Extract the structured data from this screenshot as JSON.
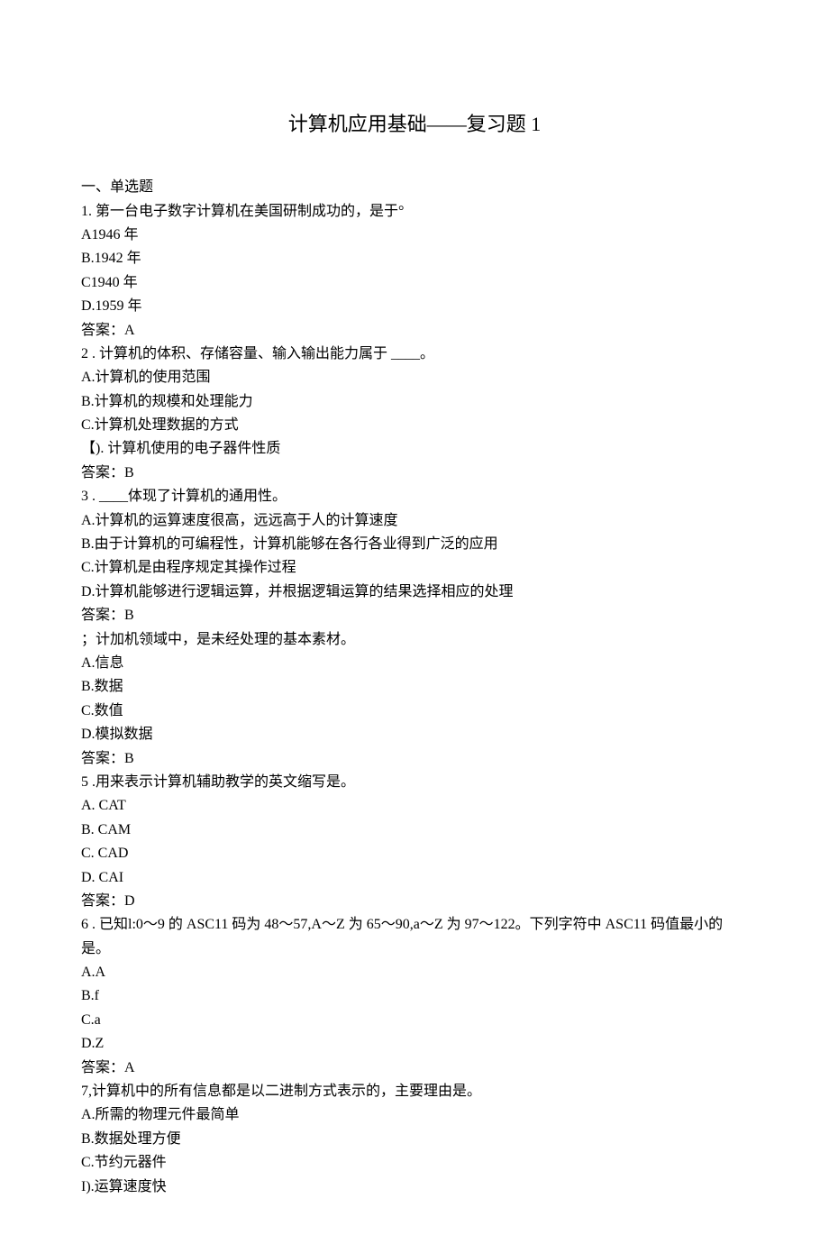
{
  "title": "计算机应用基础——复习题 1",
  "section_header": "一、单选题",
  "q1": {
    "text": "1. 第一台电子数字计算机在美国研制成功的，是于°",
    "a": "A1946 年",
    "b": "B.1942 年",
    "c": "C1940 年",
    "d": "D.1959 年",
    "ans": "答案：A"
  },
  "q2": {
    "text": "2   . 计算机的体积、存储容量、输入输出能力属于 ____。",
    "a": "A.计算机的使用范围",
    "b": "B.计算机的规模和处理能力",
    "c": "C.计算机处理数据的方式",
    "d": "【). 计算机使用的电子器件性质",
    "ans": "答案：B"
  },
  "q3": {
    "text": "3   . ____体现了计算机的通用性。",
    "a": "A.计算机的运算速度很高，远远高于人的计算速度",
    "b": "B.由于计算机的可编程性，计算机能够在各行各业得到广泛的应用",
    "c": "C.计算机是由程序规定其操作过程",
    "d": "D.计算机能够进行逻辑运算，并根据逻辑运算的结果选择相应的处理",
    "ans": "答案：B"
  },
  "q4": {
    "text": "；计加机领域中，是未经处理的基本素材。",
    "a": "A.信息",
    "b": "B.数据",
    "c": "C.数值",
    "d": "D.模拟数据",
    "ans": "答案：B"
  },
  "q5": {
    "text": "5   .用来表示计算机辅助教学的英文缩写是。",
    "a": "A.   CAT",
    "b": "B.   CAM",
    "c": "C.   CAD",
    "d": "D.   CAI",
    "ans": "答案：D"
  },
  "q6": {
    "text": "6   . 已知l:0～9 的 ASC11 码为 48～57,A～Z 为 65～90,a～Z 为 97～122。下列字符中 ASC11 码值最小的是。",
    "a": "A.A",
    "b": "B.f",
    "c": "C.a",
    "d": "D.Z",
    "ans": "答案：A"
  },
  "q7": {
    "text": "7,计算机中的所有信息都是以二进制方式表示的，主要理由是。",
    "a": "A.所需的物理元件最简单",
    "b": "B.数据处理方便",
    "c": "C.节约元器件",
    "d": "I).运算速度快"
  }
}
